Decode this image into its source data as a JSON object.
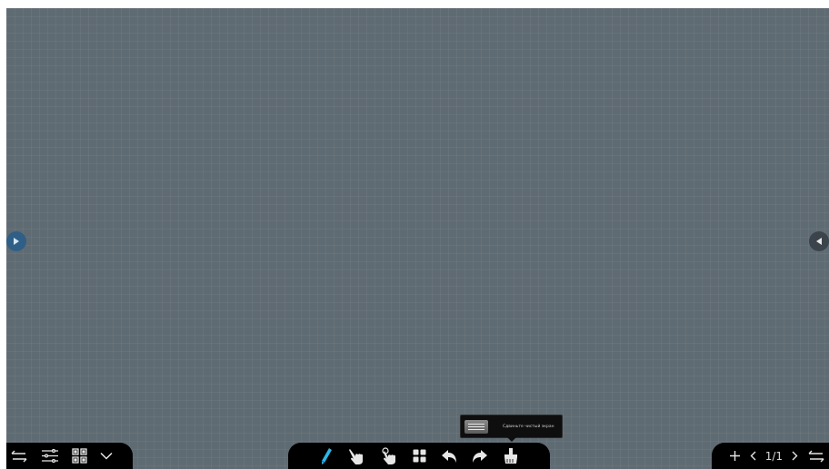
{
  "canvas": {
    "background": "#5f6b72",
    "grid": true
  },
  "side_buttons": {
    "left_icon": "arrow-right-icon",
    "right_icon": "arrow-left-icon",
    "left_color": "#2f5f86",
    "right_color": "#3b444a"
  },
  "left_toolbar": {
    "icons": [
      "swap-icon",
      "menu-lines-icon",
      "qr-grid-icon",
      "chevron-down-icon"
    ]
  },
  "center_toolbar": {
    "icons": [
      "pen-icon",
      "hand-pointer-icon",
      "hand-touch-icon",
      "apps-grid-icon",
      "undo-icon",
      "redo-icon",
      "eraser-icon"
    ],
    "accent": "#2bb7e8"
  },
  "right_toolbar": {
    "page_indicator": "1/1",
    "icons": [
      "plus-icon",
      "chevron-left-icon",
      "chevron-right-icon",
      "swap-icon"
    ]
  },
  "popup": {
    "label": "Сдвиньте чистый экран"
  }
}
